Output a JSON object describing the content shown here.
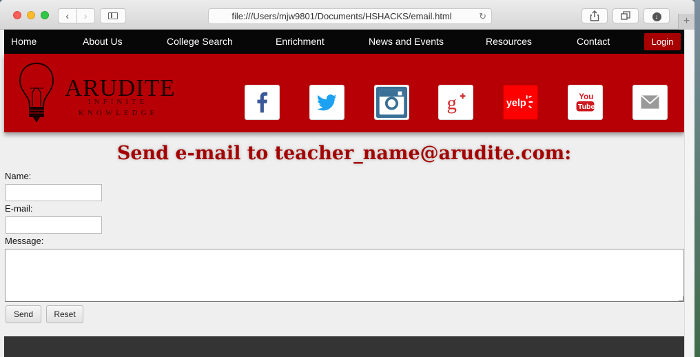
{
  "browser": {
    "url": "file:///Users/mjw9801/Documents/HSHACKS/email.html",
    "new_tab_symbol": "+"
  },
  "nav": {
    "items": [
      "Home",
      "About Us",
      "College Search",
      "Enrichment",
      "News and Events",
      "Resources",
      "Contact"
    ],
    "login": "Login"
  },
  "logo": {
    "title": "ARUDITE",
    "line1": "INFINITE",
    "line2": "KNOWLEDGE"
  },
  "social": {
    "items": [
      "facebook-icon",
      "twitter-icon",
      "instagram-icon",
      "google-plus-icon",
      "yelp-icon",
      "youtube-icon",
      "email-icon"
    ],
    "yelp_text": "yelp",
    "youtube_top": "You",
    "youtube_bottom": "Tube"
  },
  "form": {
    "heading": "Send e-mail to teacher_name@arudite.com:",
    "name_label": "Name:",
    "name_value": "",
    "email_label": "E-mail:",
    "email_value": "",
    "message_label": "Message:",
    "message_value": "",
    "send": "Send",
    "reset": "Reset"
  },
  "colors": {
    "nav_bg": "#070707",
    "banner_red": "#b70006",
    "heading_red": "#a40000",
    "login_red": "#a70000",
    "footer": "#343434"
  }
}
